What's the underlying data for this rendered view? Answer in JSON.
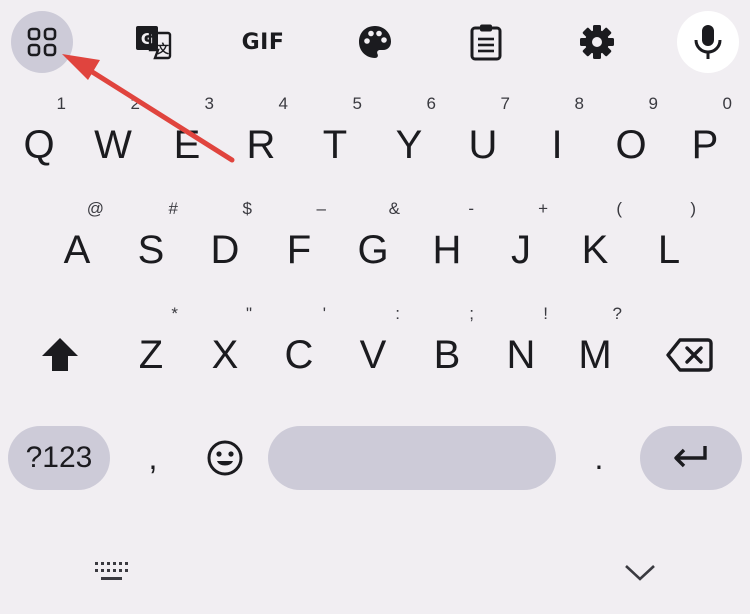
{
  "toolbar": {
    "icons": [
      "apps-icon",
      "translate-icon",
      "gif-icon",
      "palette-icon",
      "clipboard-icon",
      "gear-icon",
      "mic-icon"
    ],
    "gif_label": "GIF"
  },
  "keyboard": {
    "row1": [
      {
        "key": "Q",
        "hint": "1"
      },
      {
        "key": "W",
        "hint": "2"
      },
      {
        "key": "E",
        "hint": "3"
      },
      {
        "key": "R",
        "hint": "4"
      },
      {
        "key": "T",
        "hint": "5"
      },
      {
        "key": "Y",
        "hint": "6"
      },
      {
        "key": "U",
        "hint": "7"
      },
      {
        "key": "I",
        "hint": "8"
      },
      {
        "key": "O",
        "hint": "9"
      },
      {
        "key": "P",
        "hint": "0"
      }
    ],
    "row2": [
      {
        "key": "A",
        "hint": "@"
      },
      {
        "key": "S",
        "hint": "#"
      },
      {
        "key": "D",
        "hint": "$"
      },
      {
        "key": "F",
        "hint": "–"
      },
      {
        "key": "G",
        "hint": "&"
      },
      {
        "key": "H",
        "hint": "-"
      },
      {
        "key": "J",
        "hint": "+"
      },
      {
        "key": "K",
        "hint": "("
      },
      {
        "key": "L",
        "hint": ")"
      }
    ],
    "row3": [
      {
        "key": "Z",
        "hint": "*"
      },
      {
        "key": "X",
        "hint": "\""
      },
      {
        "key": "C",
        "hint": "'"
      },
      {
        "key": "V",
        "hint": ":"
      },
      {
        "key": "B",
        "hint": ";"
      },
      {
        "key": "N",
        "hint": "!"
      },
      {
        "key": "M",
        "hint": "?"
      }
    ],
    "bottom": {
      "symbols_label": "?123",
      "comma": ",",
      "period": "."
    }
  },
  "colors": {
    "background": "#f1eef2",
    "key_accent": "#cdcbd8",
    "annotation_arrow": "#e0443e"
  }
}
